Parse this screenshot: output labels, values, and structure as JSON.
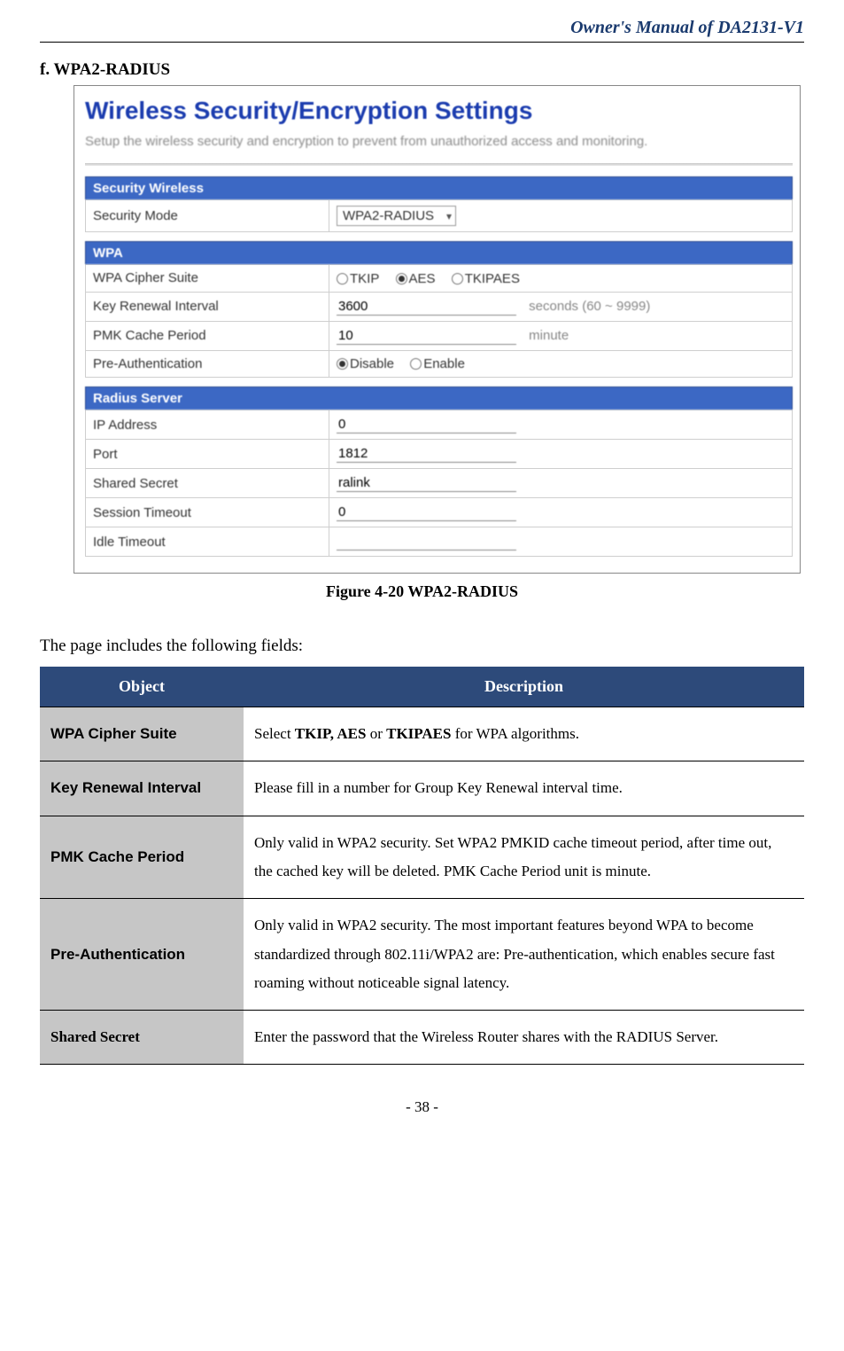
{
  "header": {
    "doc_title": "Owner's Manual of DA2131-V1"
  },
  "section_heading": "f. WPA2-RADIUS",
  "screenshot": {
    "title": "Wireless Security/Encryption Settings",
    "description": "Setup the wireless security and encryption to prevent from unauthorized access and monitoring.",
    "sec1_header": "Security Wireless",
    "security_mode_label": "Security Mode",
    "security_mode_value": "WPA2-RADIUS",
    "sec2_header": "WPA",
    "wpa_cipher_label": "WPA Cipher Suite",
    "radio_tkip": "TKIP",
    "radio_aes": "AES",
    "radio_tkipaes": "TKIPAES",
    "key_renewal_label": "Key Renewal Interval",
    "key_renewal_value": "3600",
    "key_renewal_suffix": "seconds   (60 ~ 9999)",
    "pmk_label": "PMK Cache Period",
    "pmk_value": "10",
    "pmk_suffix": "minute",
    "preauth_label": "Pre-Authentication",
    "radio_disable": "Disable",
    "radio_enable": "Enable",
    "sec3_header": "Radius Server",
    "ip_label": "IP Address",
    "ip_value": "0",
    "port_label": "Port",
    "port_value": "1812",
    "secret_label": "Shared Secret",
    "secret_value": "ralink",
    "session_label": "Session Timeout",
    "session_value": "0",
    "idle_label": "Idle Timeout",
    "idle_value": ""
  },
  "figure_caption": "Figure 4-20 WPA2-RADIUS",
  "intro_text": "The page includes the following fields:",
  "table": {
    "header_obj": "Object",
    "header_desc": "Description",
    "rows": [
      {
        "obj": "WPA Cipher Suite",
        "desc_pre": "Select ",
        "desc_b": "TKIP, AES",
        "desc_mid": " or ",
        "desc_b2": "TKIPAES",
        "desc_post": " for WPA algorithms."
      },
      {
        "obj": "Key Renewal Interval",
        "desc": "Please fill in a number for Group Key Renewal interval time."
      },
      {
        "obj": "PMK Cache Period",
        "desc": "Only valid in WPA2 security. Set WPA2 PMKID cache timeout period, after time out, the cached key will be deleted. PMK Cache Period unit is minute."
      },
      {
        "obj": "Pre-Authentication",
        "desc": "Only valid in WPA2 security. The most important features beyond WPA to become standardized through 802.11i/WPA2 are: Pre-authentication, which enables secure fast roaming without noticeable signal latency."
      },
      {
        "obj": "Shared Secret",
        "desc": "Enter the password that the Wireless Router shares with the RADIUS Server."
      }
    ]
  },
  "page_num": "- 38 -"
}
